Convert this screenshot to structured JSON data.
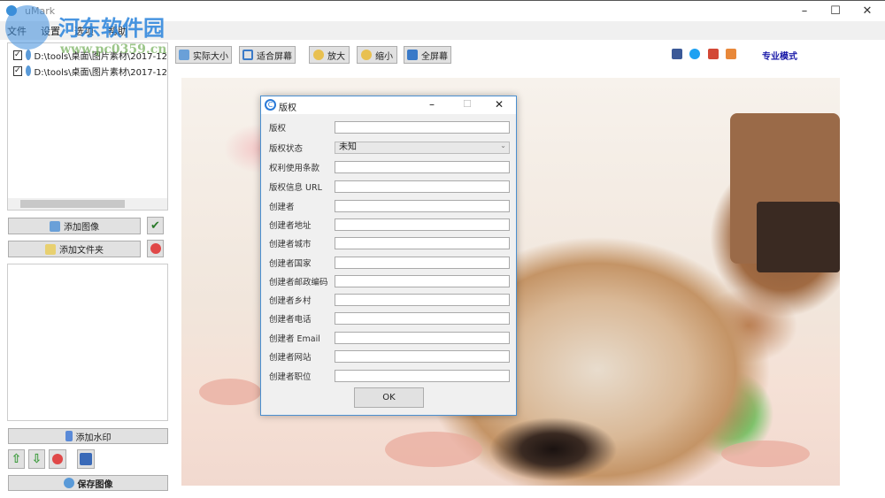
{
  "app": {
    "title": "uMark"
  },
  "menu": [
    "文件",
    "设置",
    "选项",
    "帮助"
  ],
  "watermark": {
    "name": "河东软件园",
    "url": "www.pc0359.cn"
  },
  "toolbar": {
    "actual_size": "实际大小",
    "fit_screen": "适合屏幕",
    "zoom_in": "放大",
    "zoom_out": "缩小",
    "fullscreen": "全屏幕",
    "pro_mode": "专业模式"
  },
  "social": [
    "facebook-icon",
    "twitter-icon",
    "google-plus-icon",
    "rss-icon"
  ],
  "files": [
    {
      "path": "D:\\tools\\桌面\\图片素材\\2017-12",
      "checked": true
    },
    {
      "path": "D:\\tools\\桌面\\图片素材\\2017-12",
      "checked": true
    }
  ],
  "left": {
    "add_image": "添加图像",
    "add_folder": "添加文件夹",
    "add_watermark": "添加水印",
    "save_image": "保存图像"
  },
  "dialog": {
    "title": "版权",
    "ok": "OK",
    "fields": [
      {
        "label": "版权",
        "value": ""
      },
      {
        "label": "版权状态",
        "value": "未知",
        "type": "select"
      },
      {
        "label": "权利使用条款",
        "value": ""
      },
      {
        "label": "版权信息 URL",
        "value": ""
      },
      {
        "label": "创建者",
        "value": ""
      },
      {
        "label": "创建者地址",
        "value": ""
      },
      {
        "label": "创建者城市",
        "value": ""
      },
      {
        "label": "创建者国家",
        "value": ""
      },
      {
        "label": "创建者邮政编码",
        "value": ""
      },
      {
        "label": "创建者乡村",
        "value": ""
      },
      {
        "label": "创建者电话",
        "value": ""
      },
      {
        "label": "创建者 Email",
        "value": ""
      },
      {
        "label": "创建者网站",
        "value": ""
      },
      {
        "label": "创建者职位",
        "value": ""
      }
    ]
  }
}
